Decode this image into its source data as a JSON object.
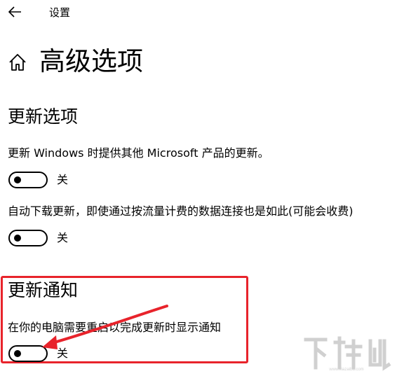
{
  "topbar": {
    "back_icon": "back-arrow-icon",
    "title": "设置"
  },
  "page": {
    "home_icon": "home-icon",
    "title": "高级选项"
  },
  "sections": [
    {
      "title": "更新选项",
      "settings": [
        {
          "description": "更新 Windows 时提供其他 Microsoft 产品的更新。",
          "state": "关",
          "on": false
        },
        {
          "description": "自动下载更新，即使通过按流量计费的数据连接也是如此(可能会收费)",
          "state": "关",
          "on": false
        }
      ]
    },
    {
      "title": "更新通知",
      "settings": [
        {
          "description": "在你的电脑需要重启以完成更新时显示通知",
          "state": "关",
          "on": false
        }
      ]
    }
  ],
  "annotation": {
    "highlight_color": "#e8232b"
  },
  "watermark": {
    "text": "下载吧"
  }
}
